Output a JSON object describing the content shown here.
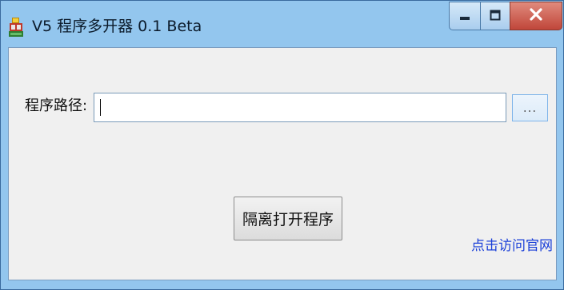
{
  "window": {
    "title": "V5 程序多开器 0.1 Beta",
    "controls": {
      "minimize": "minimize",
      "maximize": "maximize",
      "close": "close"
    }
  },
  "form": {
    "path_label": "程序路径:",
    "path_value": "",
    "browse_label": "...",
    "open_button_label": "隔离打开程序",
    "website_link": "点击访问官网"
  },
  "colors": {
    "titlebar": "#93c6ee",
    "client_bg": "#f0f0f0",
    "close_button": "#c7493c",
    "link": "#1a3fd8"
  },
  "icons": {
    "app": "app-icon",
    "minimize": "minimize-icon",
    "maximize": "maximize-icon",
    "close": "close-icon"
  }
}
